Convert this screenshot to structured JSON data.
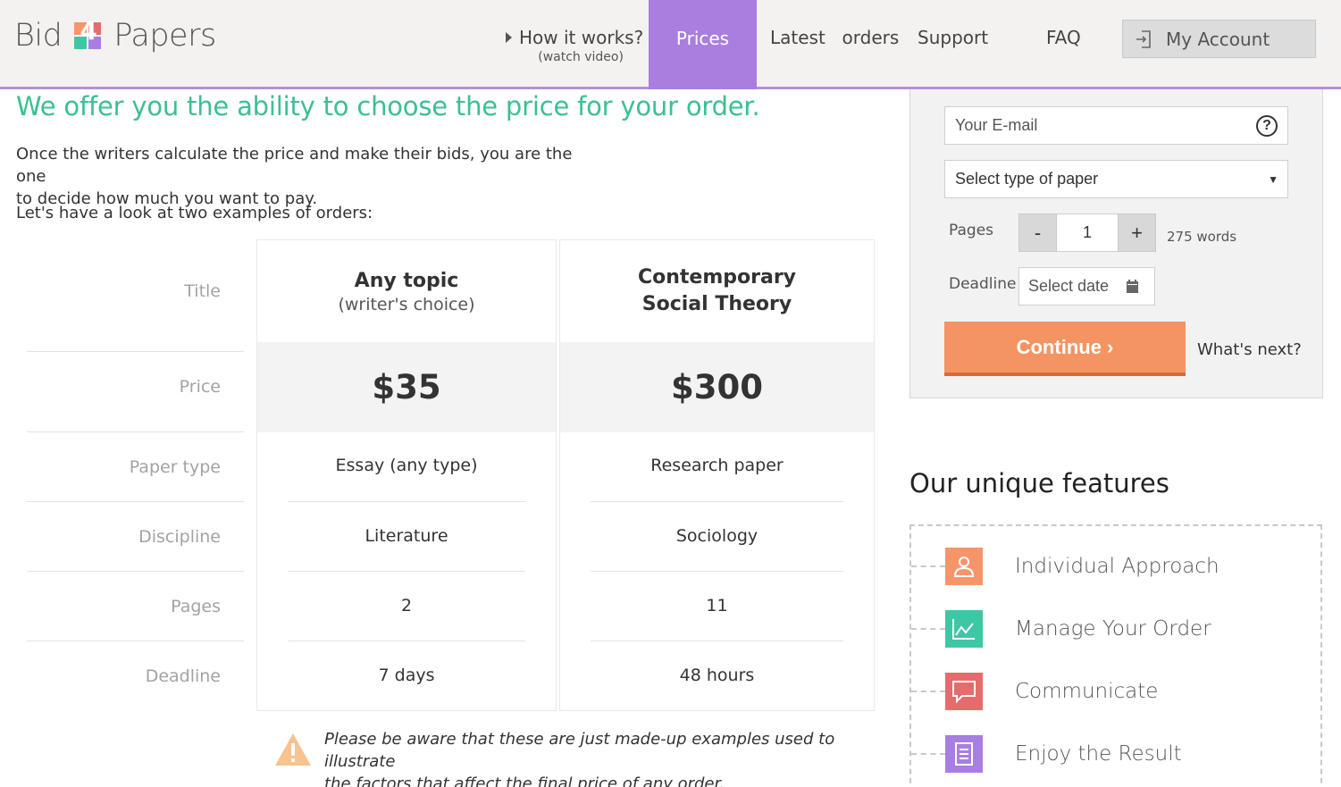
{
  "logo": {
    "left": "Bid",
    "mark": "4",
    "right": "Papers"
  },
  "nav": {
    "how_it_works": "How it works?",
    "how_it_works_sub": "(watch video)",
    "prices": "Prices",
    "latest_orders": "Latest  orders",
    "support": "Support",
    "faq": "FAQ",
    "my_account": "My Account"
  },
  "main": {
    "headline": "We offer you the ability to choose the price for your order.",
    "intro_line1": "Once the writers calculate the price and make their bids, you are the one",
    "intro_line2": "to decide how much you want to pay.",
    "look": "Let's have a look at two examples of orders:"
  },
  "table": {
    "row_labels": [
      "Title",
      "Price",
      "Paper type",
      "Discipline",
      "Pages",
      "Deadline"
    ],
    "examples": [
      {
        "title": "Any topic",
        "title_sub": "(writer's choice)",
        "price": "$35",
        "paper_type": "Essay (any type)",
        "discipline": "Literature",
        "pages": "2",
        "deadline": "7 days"
      },
      {
        "title": "Contemporary",
        "title_sub": "Social Theory",
        "price": "$300",
        "paper_type": "Research paper",
        "discipline": "Sociology",
        "pages": "11",
        "deadline": "48 hours"
      }
    ],
    "warning_line1": "Please be aware that these are just made-up examples used to illustrate",
    "warning_line2": "the factors that affect the final price of any order."
  },
  "order_form": {
    "email_placeholder": "Your E-mail",
    "help_icon": "?",
    "paper_type_select": "Select type of paper",
    "select_caret": "▼",
    "pages_label": "Pages",
    "minus": "-",
    "pages_value": "1",
    "plus": "+",
    "words": "275 words",
    "deadline_label": "Deadline",
    "date_placeholder": "Select date",
    "continue": "Continue ›",
    "whats_next": "What's next?"
  },
  "features": {
    "title": "Our unique features",
    "items": [
      {
        "label": "Individual Approach",
        "icon": "user-icon",
        "color": "#f6956a"
      },
      {
        "label": "Manage Your Order",
        "icon": "chart-icon",
        "color": "#3ec7a6"
      },
      {
        "label": "Communicate",
        "icon": "chat-icon",
        "color": "#e46c6c"
      },
      {
        "label": "Enjoy the Result",
        "icon": "document-icon",
        "color": "#a87ee2"
      }
    ]
  },
  "colors": {
    "accent_green": "#3cbf95",
    "accent_purple": "#a97edf",
    "continue_orange": "#f39462"
  }
}
